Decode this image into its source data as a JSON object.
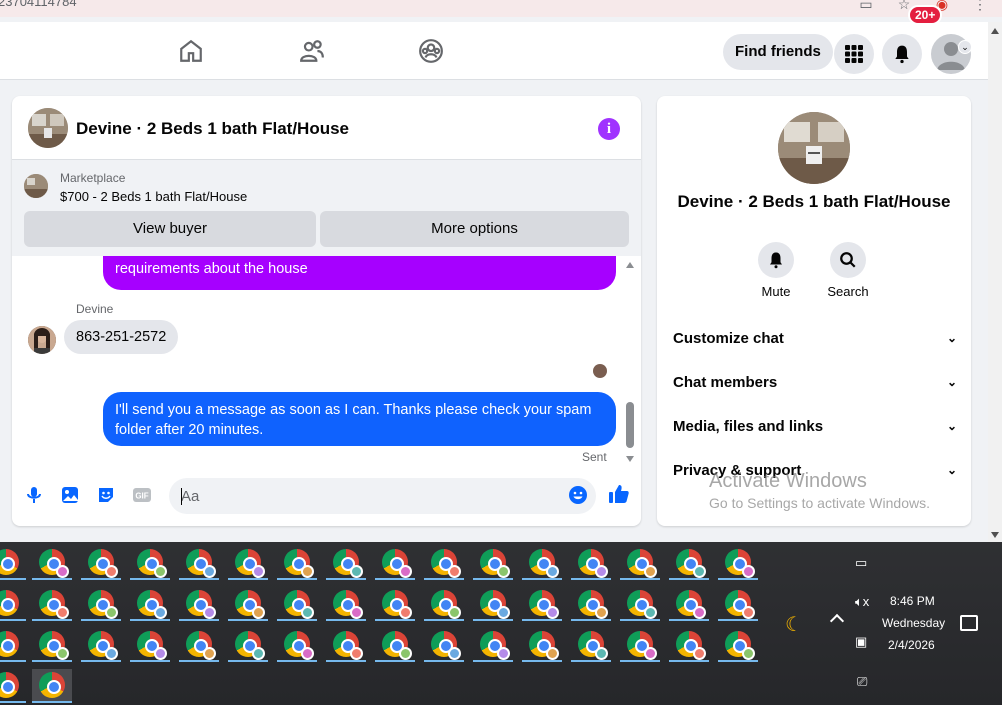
{
  "browser": {
    "url_fragment": "23704114784"
  },
  "nav": {
    "find_friends_label": "Find friends",
    "notification_count": "20+"
  },
  "chat": {
    "title": "Devine · 2 Beds 1 bath Flat/House",
    "marketplace_label": "Marketplace",
    "marketplace_listing": "$700 - 2 Beds 1 bath Flat/House",
    "view_buyer_label": "View buyer",
    "more_options_label": "More options",
    "messages": [
      {
        "type": "outgoing",
        "text": "requirements about the house"
      },
      {
        "type": "incoming",
        "sender": "Devine",
        "text": "863-251-2572"
      },
      {
        "type": "outgoing",
        "text": "I'll send you a message as soon as I can. Thanks please check your spam folder after 20 minutes."
      }
    ],
    "sent_label": "Sent",
    "composer_placeholder": "Aa"
  },
  "info": {
    "title": "Devine · 2 Beds 1 bath Flat/House",
    "mute_label": "Mute",
    "search_label": "Search",
    "rows": [
      {
        "label": "Customize chat"
      },
      {
        "label": "Chat members"
      },
      {
        "label": "Media, files and links"
      },
      {
        "label": "Privacy & support"
      }
    ]
  },
  "watermark": {
    "line1": "Activate Windows",
    "line2": "Go to Settings to activate Windows."
  },
  "tray": {
    "time": "8:46 PM",
    "day": "Wednesday",
    "date": "2/4/2026"
  },
  "colors": {
    "purple_bubble": "#a600ff",
    "blue_bubble": "#0f62fe",
    "accent": "#0866ff"
  }
}
